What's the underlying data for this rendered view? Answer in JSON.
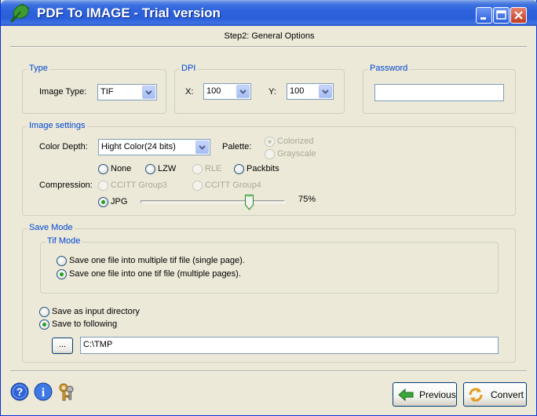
{
  "window": {
    "title": "PDF To IMAGE - Trial version",
    "step": "Step2: General Options"
  },
  "type_group": {
    "label": "Type",
    "image_type_label": "Image Type:",
    "image_type_value": "TIF"
  },
  "dpi_group": {
    "label": "DPI",
    "x_label": "X:",
    "x_value": "100",
    "y_label": "Y:",
    "y_value": "100"
  },
  "password_group": {
    "label": "Password",
    "value": ""
  },
  "image_settings": {
    "label": "Image settings",
    "color_depth_label": "Color Depth:",
    "color_depth_value": "Hight Color(24 bits)",
    "palette_label": "Palette:",
    "palette_options": [
      {
        "label": "Colorized",
        "selected": true,
        "enabled": false
      },
      {
        "label": "Grayscale",
        "selected": false,
        "enabled": false
      }
    ],
    "compression_label": "Compression:",
    "compression_options": [
      {
        "label": "None",
        "selected": false,
        "enabled": true
      },
      {
        "label": "LZW",
        "selected": false,
        "enabled": true
      },
      {
        "label": "RLE",
        "selected": false,
        "enabled": false
      },
      {
        "label": "Packbits",
        "selected": false,
        "enabled": true
      },
      {
        "label": "CCITT Group3",
        "selected": false,
        "enabled": false
      },
      {
        "label": "CCITT Group4",
        "selected": false,
        "enabled": false
      },
      {
        "label": "JPG",
        "selected": true,
        "enabled": true
      }
    ],
    "jpg_quality": 75,
    "jpg_quality_text": "75%"
  },
  "save_mode": {
    "label": "Save Mode",
    "tif_mode_label": "Tif Mode",
    "tif_options": [
      {
        "label": "Save one file into multiple tif file (single page).",
        "selected": false
      },
      {
        "label": "Save one file into one tif file (multiple pages).",
        "selected": true
      }
    ],
    "dir_options": [
      {
        "label": "Save as input directory",
        "selected": false
      },
      {
        "label": "Save to following",
        "selected": true
      }
    ],
    "browse_label": "...",
    "path_value": "C:\\TMP"
  },
  "footer": {
    "previous_label": "Previous",
    "convert_label": "Convert",
    "icons": [
      "help-icon",
      "info-icon",
      "keys-icon"
    ]
  },
  "colors": {
    "group_label": "#0046d5",
    "title_bar": "#2b5fd9",
    "radio_dot": "#21a121"
  }
}
